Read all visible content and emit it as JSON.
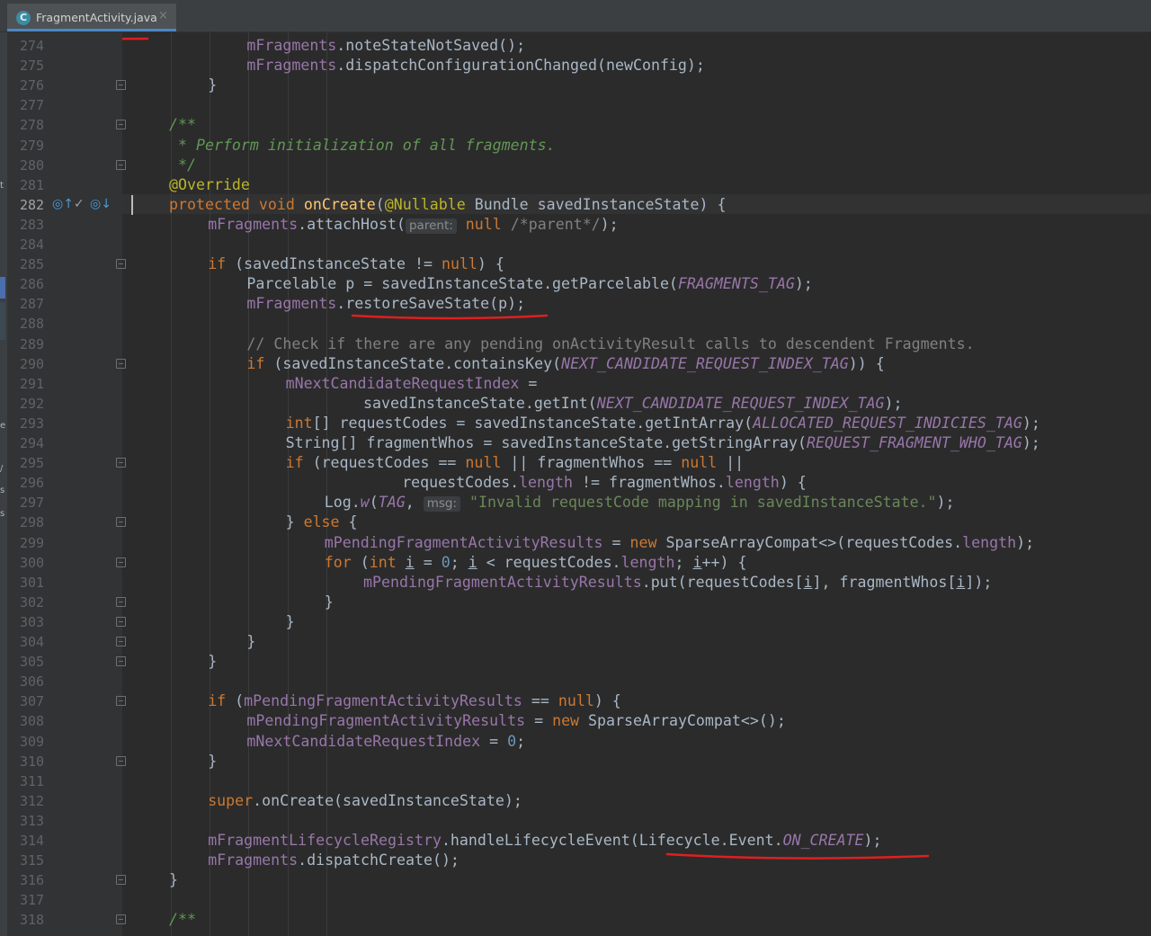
{
  "tab": {
    "title": "FragmentActivity.java",
    "icon_letter": "C",
    "close": "×"
  },
  "colors": {
    "keyword": "#cc7832",
    "field": "#9876aa",
    "method_decl": "#ffc66d",
    "string": "#6a8759",
    "number": "#6897bb",
    "annotation": "#bbb529",
    "comment": "#808080",
    "doc_comment": "#629755",
    "annotation_mark": "#e01f1f"
  },
  "gutter": {
    "current_line": "282",
    "icons": [
      "override-up-icon",
      "check-icon",
      "implements-down-icon"
    ]
  },
  "lines": [
    {
      "no": "274",
      "indent": 2,
      "tokens": [
        [
          "mFragments",
          "f"
        ],
        [
          ".noteStateNotSaved();",
          ""
        ]
      ]
    },
    {
      "no": "275",
      "indent": 2,
      "tokens": [
        [
          "mFragments",
          "f"
        ],
        [
          ".dispatchConfigurationChanged(newConfig);",
          ""
        ]
      ]
    },
    {
      "no": "276",
      "indent": 1,
      "tokens": [
        [
          "}",
          ""
        ]
      ]
    },
    {
      "no": "277",
      "indent": 0,
      "tokens": []
    },
    {
      "no": "278",
      "indent": 0,
      "tokens": [
        [
          "/**",
          "jd"
        ]
      ]
    },
    {
      "no": "279",
      "indent": 0,
      "tokens": [
        [
          " * Perform initialization of all fragments.",
          "jd"
        ]
      ]
    },
    {
      "no": "280",
      "indent": 0,
      "tokens": [
        [
          " */",
          "jd"
        ]
      ]
    },
    {
      "no": "281",
      "indent": 0,
      "tokens": [
        [
          "@Override",
          "a"
        ]
      ]
    },
    {
      "no": "282",
      "indent": 0,
      "tokens": [
        [
          "protected void ",
          "k"
        ],
        [
          "onCreate",
          "m"
        ],
        [
          "(",
          ""
        ],
        [
          "@Nullable",
          "a"
        ],
        [
          " Bundle savedInstanceState) {",
          ""
        ]
      ]
    },
    {
      "no": "283",
      "indent": 1,
      "tokens": [
        [
          "mFragments",
          "f"
        ],
        [
          ".attachHost(",
          ""
        ],
        [
          "parent:",
          "hint"
        ],
        [
          " ",
          ""
        ],
        [
          "null",
          "k"
        ],
        [
          " ",
          ""
        ],
        [
          "/*parent*/",
          "c"
        ],
        [
          ");",
          ""
        ]
      ]
    },
    {
      "no": "284",
      "indent": 0,
      "tokens": []
    },
    {
      "no": "285",
      "indent": 1,
      "tokens": [
        [
          "if ",
          "k"
        ],
        [
          "(savedInstanceState != ",
          ""
        ],
        [
          "null",
          "k"
        ],
        [
          ") {",
          ""
        ]
      ]
    },
    {
      "no": "286",
      "indent": 2,
      "tokens": [
        [
          "Parcelable p = savedInstanceState.getParcelable(",
          ""
        ],
        [
          "FRAGMENTS_TAG",
          "fi"
        ],
        [
          ");",
          ""
        ]
      ]
    },
    {
      "no": "287",
      "indent": 2,
      "tokens": [
        [
          "mFragments",
          "f"
        ],
        [
          ".restoreSaveState(p);",
          ""
        ]
      ]
    },
    {
      "no": "288",
      "indent": 0,
      "tokens": []
    },
    {
      "no": "289",
      "indent": 2,
      "tokens": [
        [
          "// Check if there are any pending onActivityResult calls to descendent Fragments.",
          "c"
        ]
      ]
    },
    {
      "no": "290",
      "indent": 2,
      "tokens": [
        [
          "if ",
          "k"
        ],
        [
          "(savedInstanceState.containsKey(",
          ""
        ],
        [
          "NEXT_CANDIDATE_REQUEST_INDEX_TAG",
          "fi"
        ],
        [
          ")) {",
          ""
        ]
      ]
    },
    {
      "no": "291",
      "indent": 3,
      "tokens": [
        [
          "mNextCandidateRequestIndex",
          "f"
        ],
        [
          " =",
          ""
        ]
      ]
    },
    {
      "no": "292",
      "indent": 5,
      "tokens": [
        [
          "savedInstanceState.getInt(",
          ""
        ],
        [
          "NEXT_CANDIDATE_REQUEST_INDEX_TAG",
          "fi"
        ],
        [
          ");",
          ""
        ]
      ]
    },
    {
      "no": "293",
      "indent": 3,
      "tokens": [
        [
          "int",
          "k"
        ],
        [
          "[] requestCodes = savedInstanceState.getIntArray(",
          ""
        ],
        [
          "ALLOCATED_REQUEST_INDICIES_TAG",
          "fi"
        ],
        [
          ");",
          ""
        ]
      ]
    },
    {
      "no": "294",
      "indent": 3,
      "tokens": [
        [
          "String[] fragmentWhos = savedInstanceState.getStringArray(",
          ""
        ],
        [
          "REQUEST_FRAGMENT_WHO_TAG",
          "fi"
        ],
        [
          ");",
          ""
        ]
      ]
    },
    {
      "no": "295",
      "indent": 3,
      "tokens": [
        [
          "if ",
          "k"
        ],
        [
          "(requestCodes == ",
          ""
        ],
        [
          "null",
          "k"
        ],
        [
          " || fragmentWhos == ",
          ""
        ],
        [
          "null",
          "k"
        ],
        [
          " ||",
          ""
        ]
      ]
    },
    {
      "no": "296",
      "indent": 6,
      "tokens": [
        [
          "requestCodes.",
          ""
        ],
        [
          "length",
          "f"
        ],
        [
          " != fragmentWhos.",
          ""
        ],
        [
          "length",
          "f"
        ],
        [
          ") {",
          ""
        ]
      ]
    },
    {
      "no": "297",
      "indent": 4,
      "tokens": [
        [
          "Log.",
          ""
        ],
        [
          "w",
          "fi"
        ],
        [
          "(",
          ""
        ],
        [
          "TAG",
          "fi"
        ],
        [
          ", ",
          ""
        ],
        [
          "msg:",
          "hint"
        ],
        [
          " ",
          ""
        ],
        [
          "\"Invalid requestCode mapping in savedInstanceState.\"",
          "s"
        ],
        [
          ");",
          ""
        ]
      ]
    },
    {
      "no": "298",
      "indent": 3,
      "tokens": [
        [
          "} ",
          ""
        ],
        [
          "else",
          "k"
        ],
        [
          " {",
          ""
        ]
      ]
    },
    {
      "no": "299",
      "indent": 4,
      "tokens": [
        [
          "mPendingFragmentActivityResults",
          "f"
        ],
        [
          " = ",
          ""
        ],
        [
          "new",
          "k"
        ],
        [
          " SparseArrayCompat<>(requestCodes.",
          ""
        ],
        [
          "length",
          "f"
        ],
        [
          ");",
          ""
        ]
      ]
    },
    {
      "no": "300",
      "indent": 4,
      "tokens": [
        [
          "for ",
          "k"
        ],
        [
          "(",
          ""
        ],
        [
          "int ",
          "k"
        ],
        [
          "i",
          "u"
        ],
        [
          " = ",
          ""
        ],
        [
          "0",
          "n"
        ],
        [
          "; ",
          ""
        ],
        [
          "i",
          "u"
        ],
        [
          " < requestCodes.",
          ""
        ],
        [
          "length",
          "f"
        ],
        [
          "; ",
          ""
        ],
        [
          "i",
          "u"
        ],
        [
          "++) {",
          ""
        ]
      ]
    },
    {
      "no": "301",
      "indent": 5,
      "tokens": [
        [
          "mPendingFragmentActivityResults",
          "f"
        ],
        [
          ".put(requestCodes[",
          ""
        ],
        [
          "i",
          "u"
        ],
        [
          "], fragmentWhos[",
          ""
        ],
        [
          "i",
          "u"
        ],
        [
          "]);",
          ""
        ]
      ]
    },
    {
      "no": "302",
      "indent": 4,
      "tokens": [
        [
          "}",
          ""
        ]
      ]
    },
    {
      "no": "303",
      "indent": 3,
      "tokens": [
        [
          "}",
          ""
        ]
      ]
    },
    {
      "no": "304",
      "indent": 2,
      "tokens": [
        [
          "}",
          ""
        ]
      ]
    },
    {
      "no": "305",
      "indent": 1,
      "tokens": [
        [
          "}",
          ""
        ]
      ]
    },
    {
      "no": "306",
      "indent": 0,
      "tokens": []
    },
    {
      "no": "307",
      "indent": 1,
      "tokens": [
        [
          "if ",
          "k"
        ],
        [
          "(",
          ""
        ],
        [
          "mPendingFragmentActivityResults",
          "f"
        ],
        [
          " == ",
          ""
        ],
        [
          "null",
          "k"
        ],
        [
          ") {",
          ""
        ]
      ]
    },
    {
      "no": "308",
      "indent": 2,
      "tokens": [
        [
          "mPendingFragmentActivityResults",
          "f"
        ],
        [
          " = ",
          ""
        ],
        [
          "new",
          "k"
        ],
        [
          " SparseArrayCompat<>();",
          ""
        ]
      ]
    },
    {
      "no": "309",
      "indent": 2,
      "tokens": [
        [
          "mNextCandidateRequestIndex",
          "f"
        ],
        [
          " = ",
          ""
        ],
        [
          "0",
          "n"
        ],
        [
          ";",
          ""
        ]
      ]
    },
    {
      "no": "310",
      "indent": 1,
      "tokens": [
        [
          "}",
          ""
        ]
      ]
    },
    {
      "no": "311",
      "indent": 0,
      "tokens": []
    },
    {
      "no": "312",
      "indent": 1,
      "tokens": [
        [
          "super",
          "k"
        ],
        [
          ".onCreate(savedInstanceState);",
          ""
        ]
      ]
    },
    {
      "no": "313",
      "indent": 0,
      "tokens": []
    },
    {
      "no": "314",
      "indent": 1,
      "tokens": [
        [
          "mFragmentLifecycleRegistry",
          "f"
        ],
        [
          ".handleLifecycleEvent(Lifecycle.Event.",
          ""
        ],
        [
          "ON_CREATE",
          "fi"
        ],
        [
          ");",
          ""
        ]
      ]
    },
    {
      "no": "315",
      "indent": 1,
      "tokens": [
        [
          "mFragments",
          "f"
        ],
        [
          ".dispatchCreate();",
          ""
        ]
      ]
    },
    {
      "no": "316",
      "indent": 0,
      "tokens": [
        [
          "}",
          ""
        ]
      ]
    },
    {
      "no": "317",
      "indent": 0,
      "tokens": []
    },
    {
      "no": "318",
      "indent": 0,
      "tokens": [
        [
          "/**",
          "jd"
        ]
      ]
    }
  ],
  "folds": [
    "276",
    "278",
    "280",
    "285",
    "290",
    "295",
    "298",
    "300",
    "302",
    "303",
    "304",
    "305",
    "307",
    "310",
    "316",
    "318"
  ],
  "strip_letters": [
    [
      "t",
      201
    ],
    [
      "e",
      468
    ],
    [
      "/",
      516
    ],
    [
      "s",
      540
    ],
    [
      "s",
      566
    ]
  ]
}
